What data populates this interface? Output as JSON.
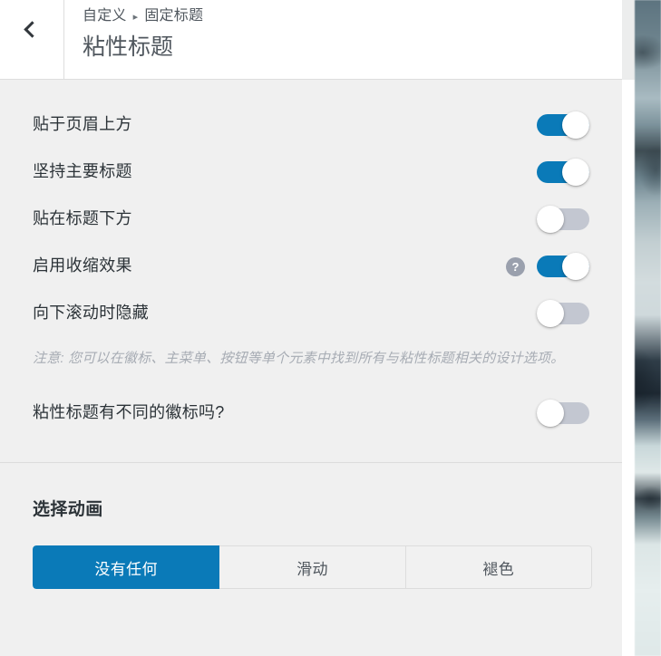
{
  "header": {
    "back_icon": "chevron-left-icon",
    "breadcrumb": {
      "parent": "自定义",
      "separator": "▶",
      "current": "固定标题"
    },
    "title": "粘性标题"
  },
  "settings": {
    "toggles": [
      {
        "label": "贴于页眉上方",
        "state": "on",
        "help": null
      },
      {
        "label": "坚持主要标题",
        "state": "on",
        "help": null
      },
      {
        "label": "贴在标题下方",
        "state": "off",
        "help": null
      },
      {
        "label": "启用收缩效果",
        "state": "on",
        "help": "?"
      },
      {
        "label": "向下滚动时隐藏",
        "state": "off",
        "help": null
      }
    ],
    "note": "注意: 您可以在徽标、主菜单、按钮等单个元素中找到所有与粘性标题相关的设计选项。",
    "logo_toggle": {
      "label": "粘性标题有不同的徽标吗?",
      "state": "off"
    }
  },
  "animation": {
    "title": "选择动画",
    "options": [
      {
        "label": "没有任何",
        "selected": true
      },
      {
        "label": "滑动",
        "selected": false
      },
      {
        "label": "褪色",
        "selected": false
      }
    ]
  },
  "colors": {
    "accent": "#0a7ab8",
    "track_off": "#c3c7d1",
    "panel_bg": "#f0f0f0",
    "text": "#2c3338",
    "muted": "#50575e",
    "note": "#a7acb4"
  }
}
